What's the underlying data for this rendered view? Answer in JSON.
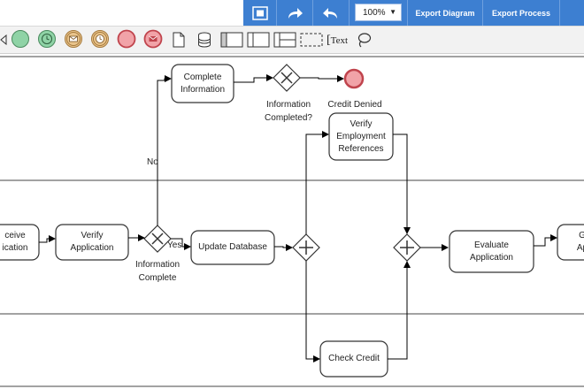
{
  "toolbar": {
    "zoom_value": "100%",
    "export_diagram_label": "Export Diagram",
    "export_process_label": "Export Process",
    "text_tool_label": "Text",
    "colors": {
      "bar": "#3d7fd1",
      "palette_bg": "#f2f2f2"
    }
  },
  "diagram": {
    "tasks": {
      "receive_application": "ceive\nication",
      "verify_application": "Verify\nApplication",
      "complete_information": "Complete\nInformation",
      "update_database": "Update Database",
      "verify_employment": "Verify\nEmployment\nReferences",
      "check_credit": "Check Credit",
      "evaluate_application": "Evaluate\nApplication",
      "next_task": "G\nAp"
    },
    "labels": {
      "no": "No",
      "yes": "Yes",
      "information_complete": "Information\nComplete",
      "information_completed_q": "Information\nCompleted?",
      "credit_denied": "Credit Denied"
    }
  }
}
